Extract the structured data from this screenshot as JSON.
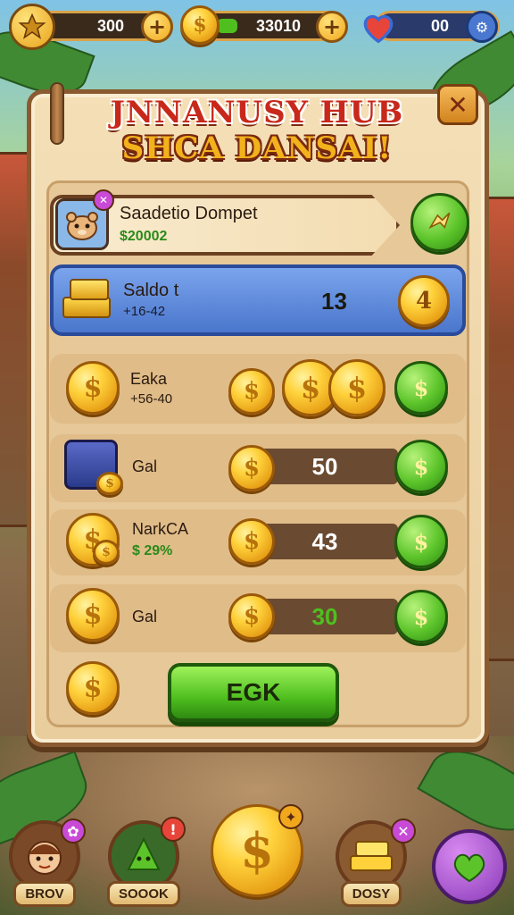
{
  "hud": {
    "stars": "300",
    "coins": "33010",
    "lives": "00",
    "coins_bar_fill": 0.18
  },
  "title": {
    "line1": "JNNANUSY HUB",
    "line2": "SHCA DANSAI!"
  },
  "close_label": "✕",
  "featured": {
    "name": "Saadetio Dompet",
    "value": "$20002"
  },
  "wallet_row": {
    "name": "Saldo t",
    "sub": "+16-42",
    "count": "13",
    "button": "4"
  },
  "rows": [
    {
      "name": "Eaka",
      "sub": "+56-40",
      "value": ""
    },
    {
      "name": "Gal",
      "sub": "",
      "value": "50"
    },
    {
      "name": "NarkCA",
      "sub": "$ 29%",
      "value": "43"
    },
    {
      "name": "Gal",
      "sub": "",
      "value": "30"
    }
  ],
  "cta_label": "EGK",
  "nav": [
    {
      "label": "BROV"
    },
    {
      "label": "SOOOK"
    },
    {
      "label": ""
    },
    {
      "label": "DOSY"
    },
    {
      "label": ""
    }
  ],
  "colors": {
    "accent_green": "#4fbf1f",
    "gold": "#ffd23c",
    "title_red": "#c8281a",
    "wallet_blue": "#5a86d6"
  }
}
